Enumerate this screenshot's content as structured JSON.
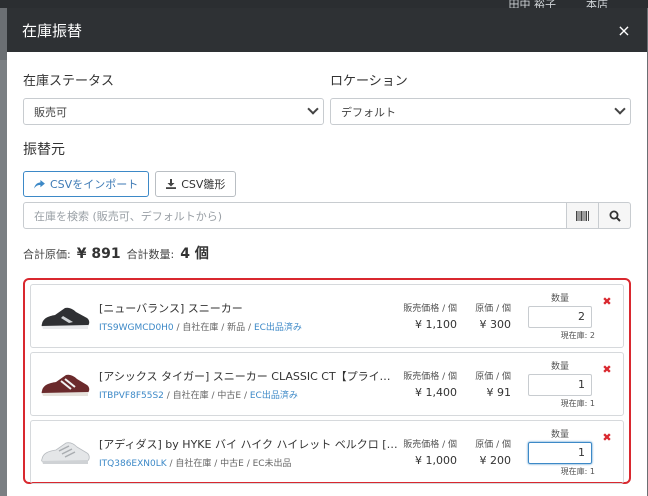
{
  "background": {
    "user_name": "田中 裕子",
    "store_name": "本店"
  },
  "modal": {
    "title": "在庫振替",
    "close_label": "×"
  },
  "form": {
    "status_label": "在庫ステータス",
    "status_value": "販売可",
    "location_label": "ロケーション",
    "location_value": "デフォルト"
  },
  "source": {
    "section_title": "振替元",
    "import_button": "CSVをインポート",
    "template_button": "CSV雛形",
    "search_placeholder": "在庫を検索 (販売可、デフォルトから)"
  },
  "totals": {
    "cost_label": "合計原価:",
    "cost_value": "¥ 891",
    "qty_label": "合計数量:",
    "qty_value": "4 個"
  },
  "columns": {
    "price_caption": "販売価格 / 個",
    "cost_caption": "原価 / 個",
    "qty_caption": "数量",
    "delete_label": "✖"
  },
  "items": [
    {
      "name": "[ニューバランス] スニーカー",
      "sku": "ITS9WGMCD0H0",
      "meta_rest": " / 自社在庫 / 新品 / ",
      "ec_status": "EC出品済み",
      "price": "¥ 1,100",
      "cost": "¥ 300",
      "qty": "2",
      "stock": "現在庫: 2",
      "shoe_color": "#2f3033"
    },
    {
      "name": "[アシックス タイガー] スニーカー CLASSIC CT【プライムデー記念発…",
      "sku": "ITBPVF8F55S2",
      "meta_rest": " / 自社在庫 / 中古E / ",
      "ec_status": "EC出品済み",
      "price": "¥ 1,400",
      "cost": "¥ 91",
      "qty": "1",
      "stock": "現在庫: 1",
      "shoe_color": "#6b2a2c"
    },
    {
      "name": "[アディダス] by HYKE バイ ハイク ハイレット ベルクロ [HYKE Haill…",
      "sku": "ITQ386EXN0LK",
      "meta_rest": " / 自社在庫 / 中古E / EC未出品",
      "ec_status": "",
      "price": "¥ 1,000",
      "cost": "¥ 200",
      "qty": "1",
      "stock": "現在庫: 1",
      "shoe_color": "#e4e6e8"
    }
  ],
  "colors": {
    "header_bg": "#2e3134",
    "accent_blue": "#3d89c7",
    "highlight_red": "#d9282f"
  }
}
